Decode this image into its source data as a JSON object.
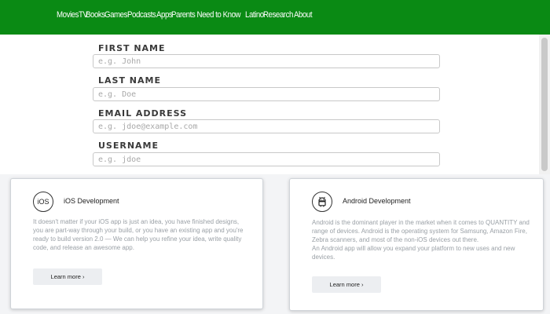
{
  "nav": {
    "items": [
      "Movies",
      "TV",
      "Books",
      "Games",
      "Podcasts",
      "Apps",
      "Parents Need to Know",
      "Latino",
      "Research",
      "About"
    ]
  },
  "form": {
    "first_name": {
      "label": "FIRST NAME",
      "placeholder": "e.g. John"
    },
    "last_name": {
      "label": "LAST NAME",
      "placeholder": "e.g. Doe"
    },
    "email": {
      "label": "EMAIL ADDRESS",
      "placeholder": "e.g. jdoe@example.com"
    },
    "username": {
      "label": "USERNAME",
      "placeholder": "e.g. jdoe"
    }
  },
  "cards": {
    "ios": {
      "icon_text": "iOS",
      "title": "iOS Development",
      "body": "It doesn't matter if your iOS app is just an idea, you have finished designs, you are part-way through your build, or you have an existing app and you're ready to build version 2.0 — We can help you refine your idea, write quality code, and release an awesome app.",
      "button": "Learn more ›"
    },
    "android": {
      "title": "Android Development",
      "body_1": "Android is the dominant player in the market when it comes to QUANTITY and range of devices. Android is the operating system for Samsung, Amazon Fire, Zebra scanners, and most of the non-iOS devices out there.",
      "body_2": "An Android app will allow you expand your platform to new uses and new devices.",
      "button": "Learn more ›"
    }
  },
  "colors": {
    "nav_bg": "#0a8a14",
    "lower_bg": "#f3f4f6"
  }
}
